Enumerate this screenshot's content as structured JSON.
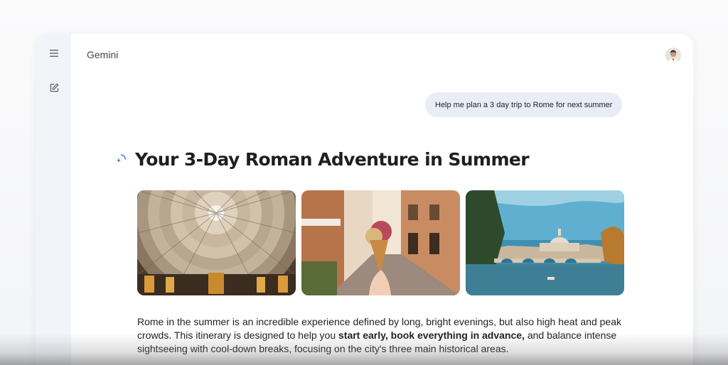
{
  "app": {
    "title": "Gemini"
  },
  "sidebar": {
    "menu_icon": "hamburger-menu-icon",
    "new_chat_icon": "edit-square-icon"
  },
  "user": {
    "avatar_icon": "user-avatar"
  },
  "conversation": {
    "user_prompt": "Help me plan a 3 day trip to Rome for next summer",
    "response": {
      "spark_icon": "gemini-spark-icon",
      "title": "Your 3-Day Roman Adventure in Summer",
      "images": [
        {
          "subject": "pantheon-dome-interior"
        },
        {
          "subject": "gelato-cone-rome-street"
        },
        {
          "subject": "tiber-river-st-peters-basilica"
        }
      ],
      "paragraph": {
        "part1": "Rome in the summer is an incredible experience defined by long, bright evenings, but also high heat and peak crowds. This itinerary is designed to help you ",
        "bold": "start early, book everything in advance,",
        "part2": " and balance intense sightseeing with cool-down breaks, focusing on the city's three main historical areas."
      }
    }
  },
  "colors": {
    "accent_blue": "#4a7fe3",
    "prompt_bubble_bg": "#e9eef6",
    "rail_bg": "#f1f4f9"
  }
}
